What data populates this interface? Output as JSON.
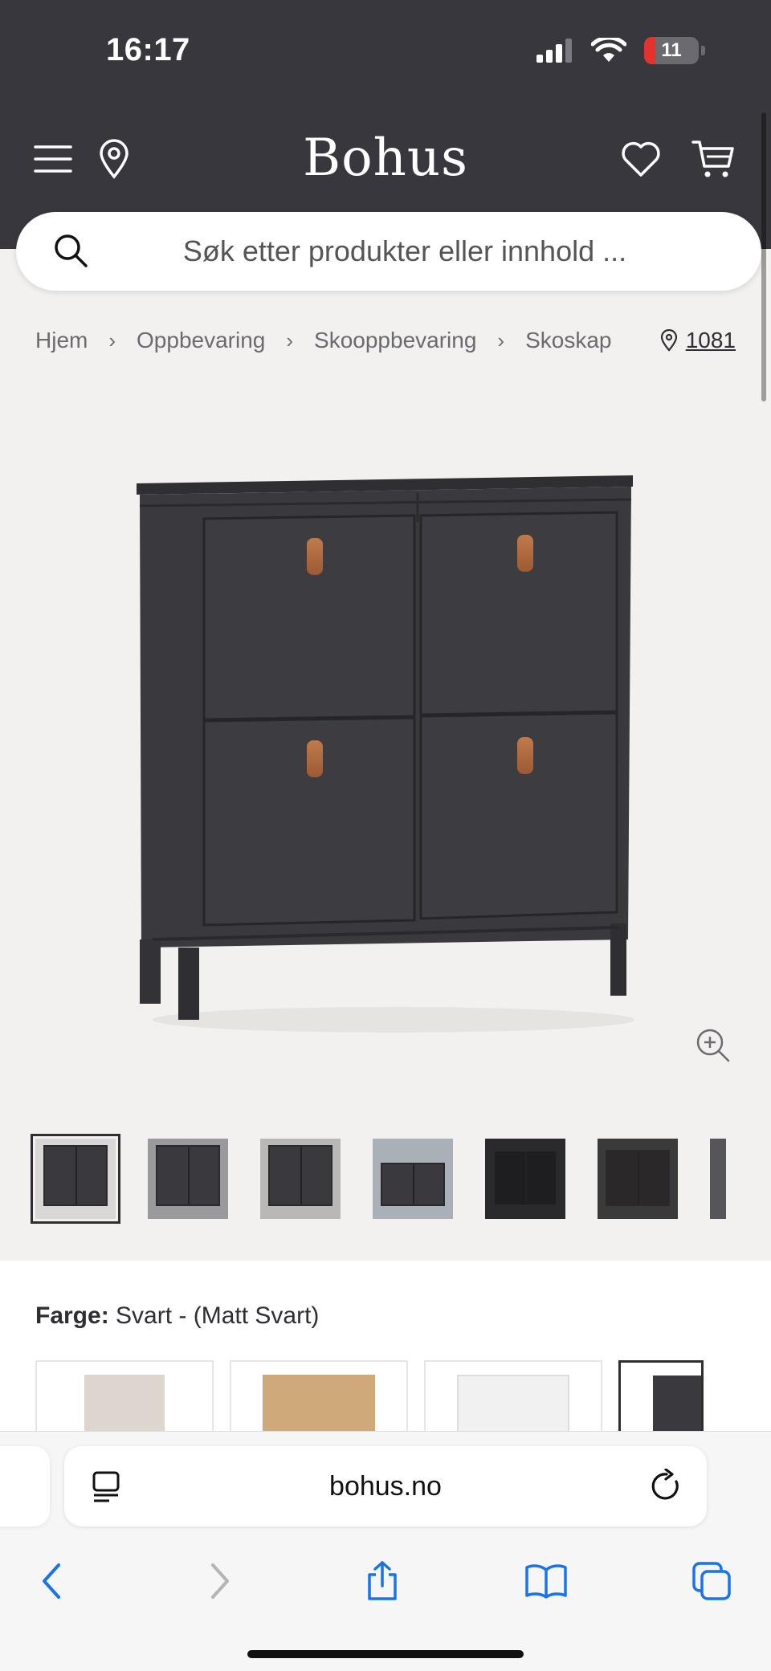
{
  "status": {
    "time": "16:17",
    "battery": "11"
  },
  "header": {
    "logo": "Bohus"
  },
  "search": {
    "placeholder": "Søk etter produkter eller innhold ..."
  },
  "breadcrumb": {
    "items": [
      {
        "label": "Hjem"
      },
      {
        "label": "Oppbevaring"
      },
      {
        "label": "Skooppbevaring"
      },
      {
        "label": "Skoskap"
      }
    ],
    "store_code": "1081"
  },
  "product": {
    "color_label": "Farge:",
    "color_value": "Svart - (Matt Svart)",
    "swatches": [
      {
        "name": "beige",
        "color": "#ddd6cf"
      },
      {
        "name": "oak",
        "color": "#cfa979"
      },
      {
        "name": "white",
        "color": "#f4f4f4"
      },
      {
        "name": "black",
        "color": "#3a3a3e"
      }
    ],
    "thumbnail_count": 6
  },
  "browser": {
    "url": "bohus.no"
  },
  "colors": {
    "header_bg": "#37373d",
    "page_bg": "#f3f1ef",
    "accent_link": "#1a73e8"
  }
}
